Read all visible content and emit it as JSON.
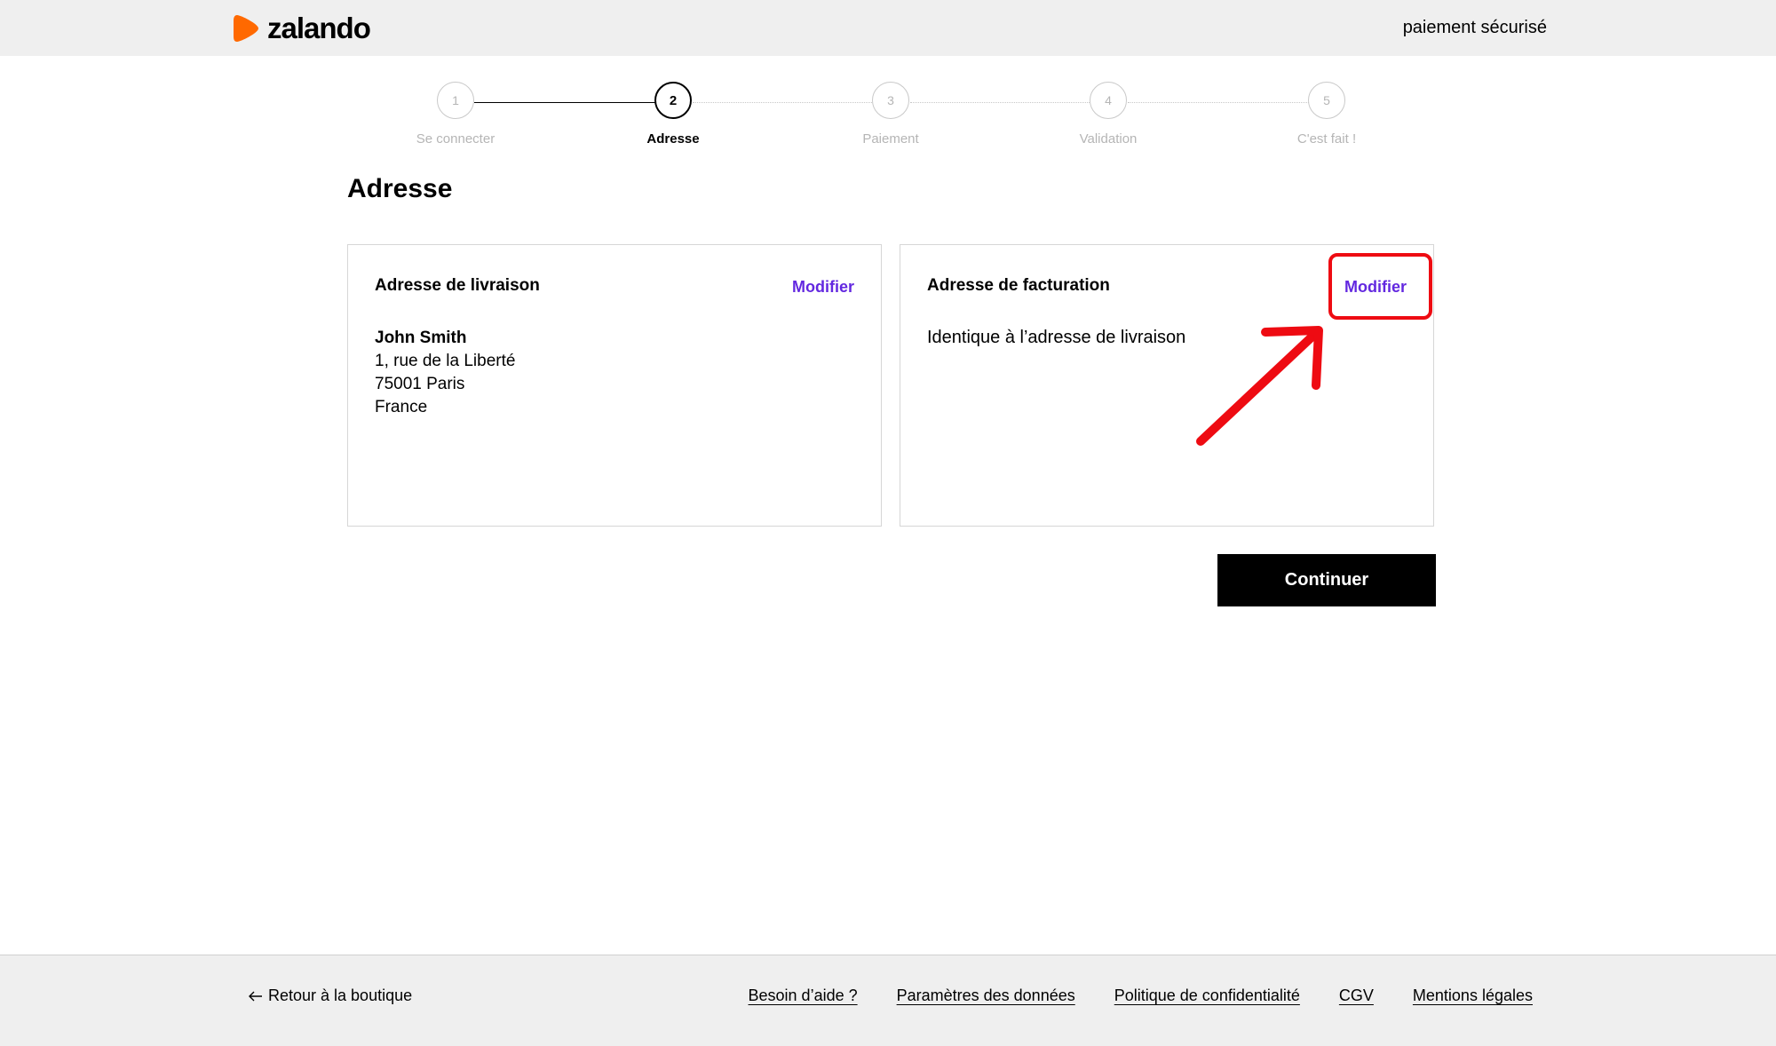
{
  "header": {
    "logo_text": "zalando",
    "secure_label": "paiement sécurisé",
    "brand_color": "#ff6900"
  },
  "stepper": {
    "current_step": 2,
    "steps": [
      {
        "number": "1",
        "label": "Se connecter"
      },
      {
        "number": "2",
        "label": "Adresse"
      },
      {
        "number": "3",
        "label": "Paiement"
      },
      {
        "number": "4",
        "label": "Validation"
      },
      {
        "number": "5",
        "label": "C'est fait !"
      }
    ]
  },
  "main": {
    "title": "Adresse",
    "delivery": {
      "title": "Adresse de livraison",
      "edit_label": "Modifier",
      "name": "John Smith",
      "line1": "1, rue de la Liberté",
      "line2": "75001 Paris",
      "country": "France"
    },
    "billing": {
      "title": "Adresse de facturation",
      "edit_label": "Modifier",
      "text": "Identique à l’adresse de livraison"
    },
    "continue_label": "Continuer",
    "link_color": "#6328e0",
    "annotation_color": "#ee0b12"
  },
  "footer": {
    "back_label": "Retour à la boutique",
    "links": [
      "Besoin d’aide ?",
      "Paramètres des données",
      "Politique de confidentialité",
      "CGV",
      "Mentions légales"
    ]
  }
}
